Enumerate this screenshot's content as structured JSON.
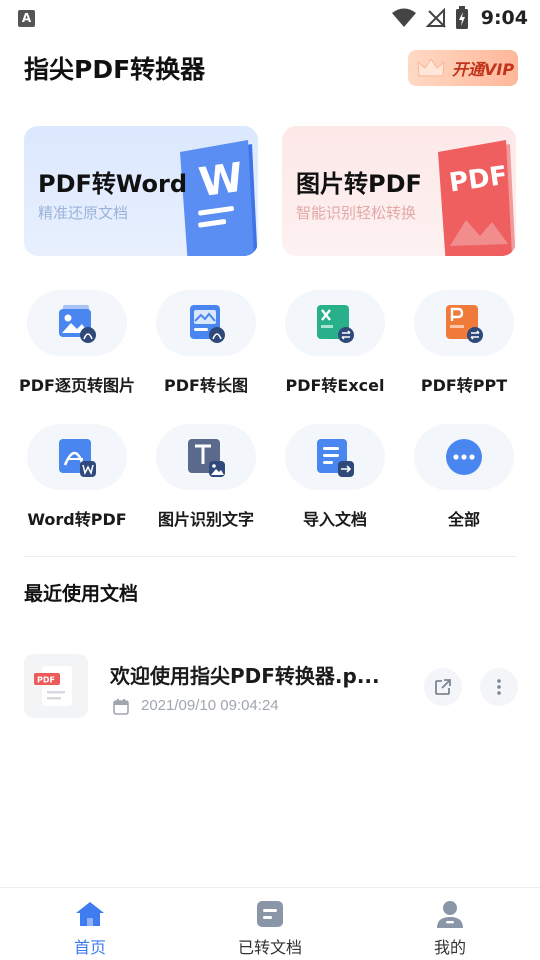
{
  "status_bar": {
    "notification_icon": "A",
    "time": "9:04",
    "icons": [
      "wifi-icon",
      "no-signal-icon",
      "battery-charging-icon"
    ]
  },
  "header": {
    "title": "指尖PDF转换器",
    "vip_label": "开通VIP"
  },
  "feature_cards": [
    {
      "title": "PDF转Word",
      "subtitle": "精准还原文档",
      "icon": "word-doc-icon",
      "art_text": "W"
    },
    {
      "title": "图片转PDF",
      "subtitle": "智能识别轻松转换",
      "icon": "pdf-doc-icon",
      "art_text": "PDF"
    }
  ],
  "tools": [
    {
      "label": "PDF逐页转图片",
      "icon": "pdf-to-image-icon"
    },
    {
      "label": "PDF转长图",
      "icon": "pdf-to-long-image-icon"
    },
    {
      "label": "PDF转Excel",
      "icon": "pdf-to-excel-icon"
    },
    {
      "label": "PDF转PPT",
      "icon": "pdf-to-ppt-icon"
    },
    {
      "label": "Word转PDF",
      "icon": "word-to-pdf-icon"
    },
    {
      "label": "图片识别文字",
      "icon": "image-ocr-icon"
    },
    {
      "label": "导入文档",
      "icon": "import-doc-icon"
    },
    {
      "label": "全部",
      "icon": "more-dots-icon"
    }
  ],
  "recent": {
    "title": "最近使用文档",
    "items": [
      {
        "name": "欢迎使用指尖PDF转换器.p...",
        "date": "2021/09/10 09:04:24",
        "thumb_label": "PDF"
      }
    ]
  },
  "bottom_nav": [
    {
      "label": "首页",
      "icon": "home-icon",
      "active": true
    },
    {
      "label": "已转文档",
      "icon": "converted-docs-icon",
      "active": false
    },
    {
      "label": "我的",
      "icon": "profile-icon",
      "active": false
    }
  ],
  "colors": {
    "accent_blue": "#3f7cf0",
    "word_blue": "#4a86f0",
    "pdf_red": "#ec5a5a",
    "excel_green": "#28b08a",
    "ppt_orange": "#f07a3a",
    "vip_text": "#c2331b"
  }
}
